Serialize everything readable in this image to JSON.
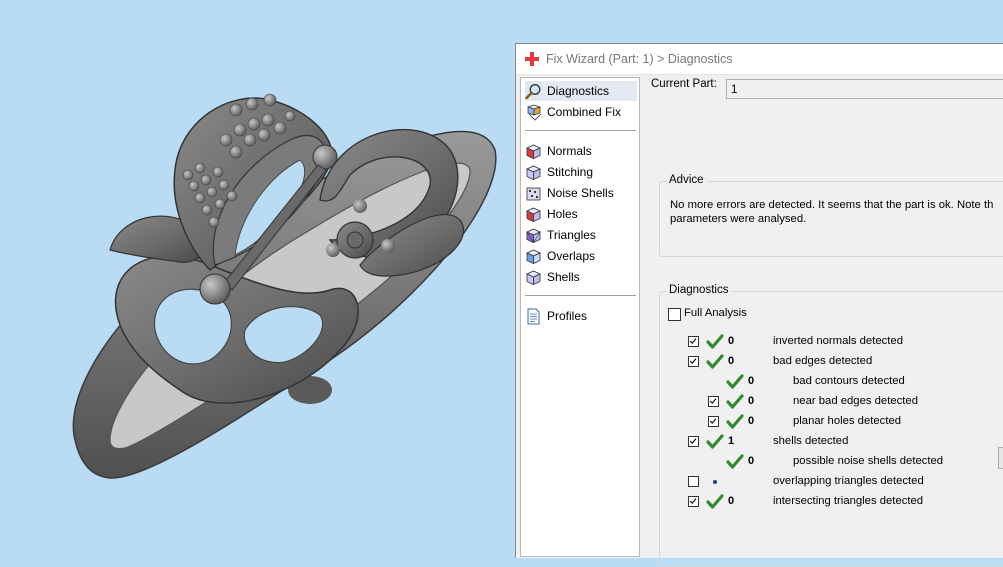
{
  "dialog": {
    "title": "Fix Wizard (Part: 1) > Diagnostics",
    "accent_color": "#e03a3a"
  },
  "nav": {
    "groups": [
      [
        {
          "label": "Diagnostics",
          "icon": "magnifier-icon",
          "selected": true
        },
        {
          "label": "Combined Fix",
          "icon": "combined-fix-icon",
          "selected": false
        }
      ],
      [
        {
          "label": "Normals",
          "icon": "normals-cube-icon"
        },
        {
          "label": "Stitching",
          "icon": "stitching-cube-icon"
        },
        {
          "label": "Noise Shells",
          "icon": "noise-shells-icon"
        },
        {
          "label": "Holes",
          "icon": "holes-cube-icon"
        },
        {
          "label": "Triangles",
          "icon": "triangles-cube-icon"
        },
        {
          "label": "Overlaps",
          "icon": "overlaps-cube-icon"
        },
        {
          "label": "Shells",
          "icon": "shells-cube-icon"
        }
      ],
      [
        {
          "label": "Profiles",
          "icon": "profiles-document-icon"
        }
      ]
    ]
  },
  "current_part": {
    "label": "Current Part:",
    "value": "1"
  },
  "advice": {
    "title": "Advice",
    "line1": "No more errors are detected. It seems that the part is ok. Note th",
    "line2": "parameters were analysed."
  },
  "diagnostics": {
    "title": "Diagnostics",
    "full_analysis": {
      "label": "Full Analysis",
      "checked": false
    },
    "rows": [
      {
        "checkbox": true,
        "checked": true,
        "status": "check",
        "value": "0",
        "label": "inverted normals detected",
        "indent": 0
      },
      {
        "checkbox": true,
        "checked": true,
        "status": "check",
        "value": "0",
        "label": "bad edges detected",
        "indent": 0
      },
      {
        "checkbox": false,
        "checked": false,
        "status": "check",
        "value": "0",
        "label": "bad contours detected",
        "indent": 1
      },
      {
        "checkbox": true,
        "checked": true,
        "status": "check",
        "value": "0",
        "label": "near bad edges detected",
        "indent": 1
      },
      {
        "checkbox": true,
        "checked": true,
        "status": "check",
        "value": "0",
        "label": "planar holes detected",
        "indent": 1
      },
      {
        "checkbox": true,
        "checked": true,
        "status": "check",
        "value": "1",
        "label": "shells detected",
        "indent": 0
      },
      {
        "checkbox": false,
        "checked": false,
        "status": "check",
        "value": "0",
        "label": "possible noise shells detected",
        "indent": 1
      },
      {
        "checkbox": true,
        "checked": false,
        "status": "dot",
        "value": "",
        "label": "overlapping triangles detected",
        "indent": 0
      },
      {
        "checkbox": true,
        "checked": true,
        "status": "check",
        "value": "0",
        "label": "intersecting triangles detected",
        "indent": 0
      }
    ],
    "check_color": "#2e8b2e"
  }
}
